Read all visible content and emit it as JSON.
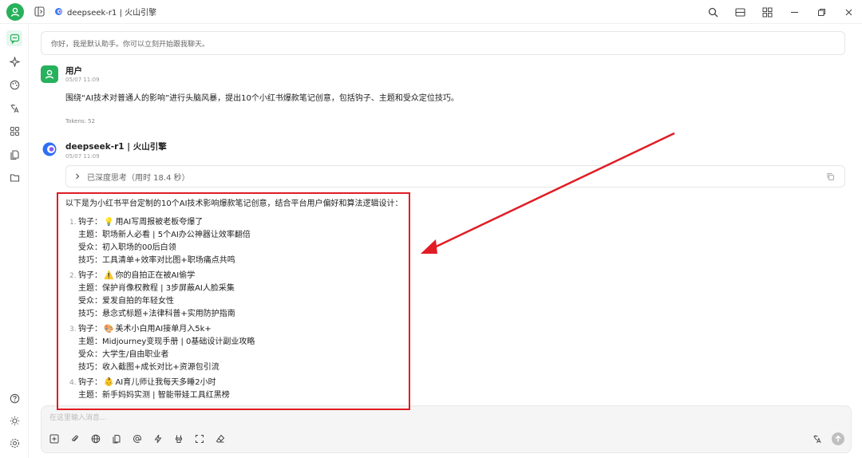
{
  "titlebar": {
    "model_title": "deepseek-r1 | 火山引擎"
  },
  "greeting": {
    "text": "你好，我是默认助手。你可以立刻开始跟我聊天。"
  },
  "user_message": {
    "name": "用户",
    "time": "05/07 11:09",
    "text": "围绕“AI技术对普通人的影响”进行头脑风暴，提出10个小红书爆款笔记创意，包括钩子、主题和受众定位技巧。",
    "tokens": "Tokens: 52"
  },
  "assistant_message": {
    "name": "deepseek-r1 | 火山引擎",
    "time": "05/07 11:09",
    "thinking": "已深度思考（用时 18.4 秒）",
    "intro": "以下是为小红书平台定制的10个AI技术影响爆款笔记创意，结合平台用户偏好和算法逻辑设计：",
    "ideas": [
      {
        "num": "1.",
        "hook_label": "钩子：",
        "hook_emoji": "💡",
        "hook": "用AI写周报被老板夸爆了",
        "topic": "主题：职场新人必看 | 5个AI办公神器让效率翻倍",
        "audience": "受众：初入职场的00后白领",
        "technique": "技巧：工具清单+效率对比图+职场痛点共鸣"
      },
      {
        "num": "2.",
        "hook_label": "钩子：",
        "hook_emoji": "⚠️",
        "hook": "你的自拍正在被AI偷学",
        "topic": "主题：保护肖像权教程 | 3步屏蔽AI人脸采集",
        "audience": "受众：爱发自拍的年轻女性",
        "technique": "技巧：悬念式标题+法律科普+实用防护指南"
      },
      {
        "num": "3.",
        "hook_label": "钩子：",
        "hook_emoji": "🎨",
        "hook": "美术小白用AI接单月入5k+",
        "topic": "主题：Midjourney变现手册 | 0基础设计副业攻略",
        "audience": "受众：大学生/自由职业者",
        "technique": "技巧：收入截图+成长对比+资源包引流"
      },
      {
        "num": "4.",
        "hook_label": "钩子：",
        "hook_emoji": "👶",
        "hook": "AI育儿师让我每天多睡2小时",
        "topic": "主题：新手妈妈实测 | 智能带娃工具红黑榜"
      }
    ]
  },
  "input": {
    "placeholder": "在这里输入消息..."
  },
  "colors": {
    "accent": "#27b15c",
    "annotation_red": "#e11c24"
  }
}
